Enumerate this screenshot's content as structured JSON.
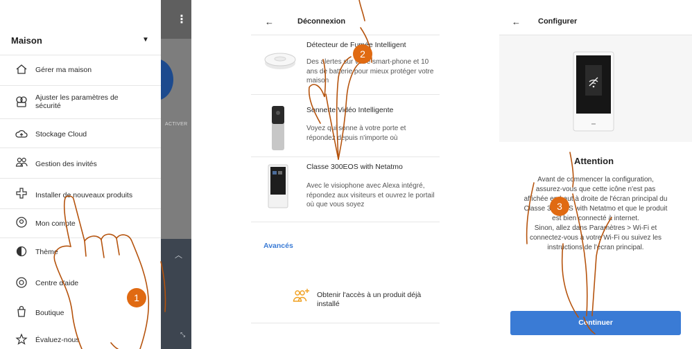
{
  "screen1": {
    "home_title": "Maison",
    "app_bar_menu": "⋮",
    "background_label": "ACTIVER",
    "menu_items": [
      {
        "label": "Gérer ma maison",
        "icon": "home-icon"
      },
      {
        "label": "Ajuster les paramètres de sécurité",
        "icon": "security-icon"
      },
      {
        "label": "Stockage Cloud",
        "icon": "cloud-icon"
      },
      {
        "label": "Gestion des invités",
        "icon": "guests-icon"
      },
      {
        "label": "Installer de nouveaux produits",
        "icon": "install-icon"
      },
      {
        "label": "Mon compte",
        "icon": "account-icon"
      },
      {
        "label": "Thème",
        "icon": "theme-icon"
      },
      {
        "label": "Centre d'aide",
        "icon": "help-icon"
      },
      {
        "label": "Boutique",
        "icon": "shop-icon"
      },
      {
        "label": "Évaluez-nous",
        "icon": "star-icon"
      }
    ],
    "step_marker": "1"
  },
  "screen2": {
    "title": "Déconnexion",
    "products": [
      {
        "title": "Détecteur de Fumée Intelligent",
        "description": "Des alertes sur votre smart-phone et 10 ans de batterie pour mieux protéger votre maison"
      },
      {
        "title": "Sonnette Vidéo Intelligente",
        "description": "Voyez qui sonne à votre porte et répondez depuis n'importe où"
      },
      {
        "title": "Classe 300EOS with Netatmo",
        "description": "Avec le visiophone avec Alexa intégré, répondez aux visiteurs et ouvrez le portail où que vous soyez"
      }
    ],
    "advanced_label": "Avancés",
    "access_label": "Obtenir l'accès à un produit déjà installé",
    "step_marker": "2"
  },
  "screen3": {
    "title": "Configurer",
    "warning_title": "Attention",
    "warning_lines": [
      "Avant de commencer la configuration,",
      "assurez-vous que cette icône n'est pas",
      "affichée en haut à droite de l'écran principal du",
      "Classe 300EOS with Netatmo et que le produit",
      "est bien connecté à internet.",
      "Sinon, allez dans Paramètres > Wi-Fi et",
      "connectez-vous à votre Wi-Fi ou suivez les",
      "instructions de l'écran principal."
    ],
    "continue_label": "Continuer",
    "step_marker": "3"
  },
  "colors": {
    "accent": "#3a7bd5",
    "marker": "#e06a12",
    "hand_outline": "#b5530d",
    "overlay_gray": "#7d7d7d"
  }
}
